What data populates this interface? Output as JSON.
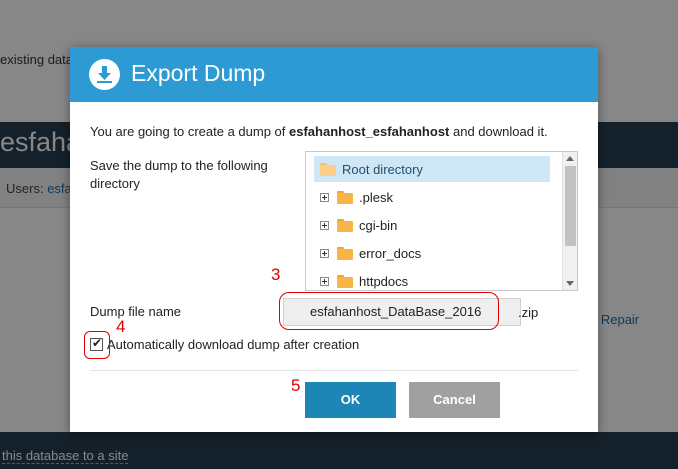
{
  "background": {
    "existing_text": "existing datab",
    "band_title": "esfaha",
    "users_label": "Users:",
    "users_link": "esfa",
    "repair_link": "d Repair",
    "assign_link": "this database to a site"
  },
  "dialog": {
    "title": "Export Dump",
    "icon": "download-icon",
    "intro_prefix": "You are going to create a dump of ",
    "intro_db": "esfahanhost_esfahanhost",
    "intro_suffix": " and download it.",
    "save_label": "Save the dump to the following directory",
    "tree": [
      {
        "label": "Root directory",
        "selected": true,
        "expandable": false
      },
      {
        "label": ".plesk",
        "selected": false,
        "expandable": true
      },
      {
        "label": "cgi-bin",
        "selected": false,
        "expandable": true
      },
      {
        "label": "error_docs",
        "selected": false,
        "expandable": true
      },
      {
        "label": "httpdocs",
        "selected": false,
        "expandable": true
      }
    ],
    "dump_file_label": "Dump file name",
    "dump_file_value": "esfahanhost_DataBase_2016",
    "dump_file_ext": ".zip",
    "auto_download_label": "Automatically download dump after creation",
    "auto_download_checked": true,
    "ok_label": "OK",
    "cancel_label": "Cancel"
  },
  "annotations": {
    "three": "3",
    "four": "4",
    "five": "5"
  },
  "colors": {
    "header": "#2d9ad3",
    "ok_button": "#1e86b6",
    "cancel_button": "#a0a0a0",
    "annotation": "#e00000"
  }
}
